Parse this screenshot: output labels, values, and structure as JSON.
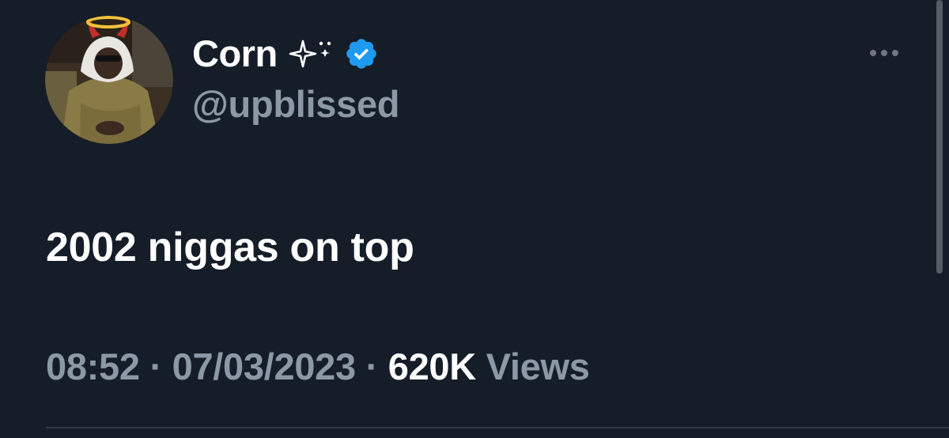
{
  "tweet": {
    "author": {
      "display_name": "Corn",
      "name_decoration_icon": "sparkle-stars-icon",
      "verified_icon": "verified-badge-icon",
      "handle": "@upblissed",
      "avatar_icon": "avatar"
    },
    "more_icon": "more-options-icon",
    "text": "2002 niggas on top",
    "time": "08:52",
    "separator_1": "·",
    "date": "07/03/2023",
    "separator_2": "·",
    "views_count": "620K",
    "views_label": "Views"
  },
  "colors": {
    "background": "#151d28",
    "primary_text": "#ffffff",
    "secondary_text": "#8b98a5",
    "verified_blue": "#1d9bf0"
  }
}
